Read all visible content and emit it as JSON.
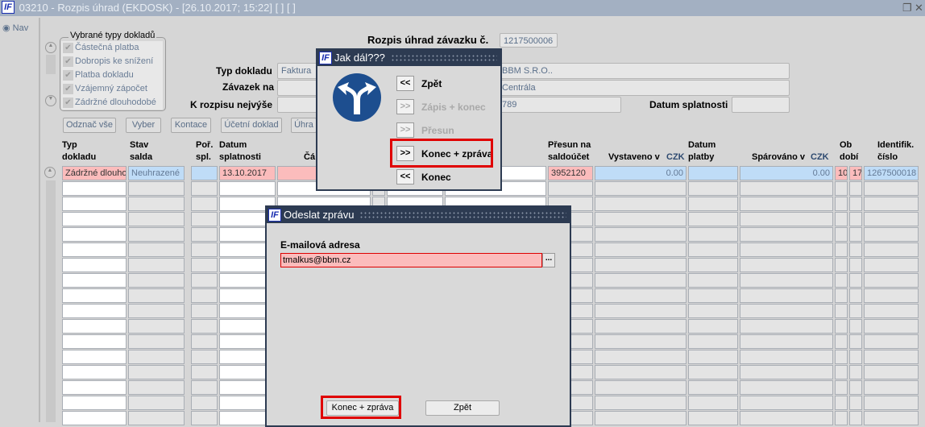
{
  "window": {
    "title": "03210 - Rozpis úhrad (EKDOSK) - [26.10.2017; 15:22]  [ ]  [ ]",
    "logo": "IF"
  },
  "nav": {
    "label": "Nav"
  },
  "doc_types": {
    "legend": "Vybrané typy dokladů",
    "items": [
      "Částečná platba",
      "Dobropis ke snížení",
      "Platba dokladu",
      "Vzájemný zápočet",
      "Zádržné dlouhodobé"
    ]
  },
  "header": {
    "title": "Rozpis úhrad závazku č.",
    "number": "1217500006",
    "typ_label": "Typ dokladu",
    "typ_value": "Faktura",
    "partner": "BBM S.R.O..",
    "zavazek_label": "Závazek na",
    "zavazek_value": "Centrála",
    "rozpis_label": "K rozpisu nejvýše",
    "rozpis_value": "789",
    "splatnost_label": "Datum splatnosti",
    "splatnost_value": ""
  },
  "toolbar": [
    "Odznač vše",
    "Vyber",
    "Kontace",
    "Účetní doklad",
    "Úhra"
  ],
  "table": {
    "headers": {
      "typ": "Typ\ndokladu",
      "stav": "Stav\nsalda",
      "por": "Poř.\nspl.",
      "datum": "Datum\nsplatnosti",
      "castka": "Čá",
      "presun": "Přesun na\nsaldoúčet",
      "vystaveno": "Vystaveno v",
      "czk": "CZK",
      "platby": "Datum\nplatby",
      "sparovano": "Spárováno v",
      "ob": "Ob\ndobí",
      "ident": "Identifik.\nčíslo"
    },
    "row": {
      "typ": "Zádržné dlouhodobé",
      "stav": "Neuhrazené",
      "datum": "13.10.2017",
      "presun": "3952120",
      "vystaveno": "0.00",
      "sparovano": "0.00",
      "ob1": "10",
      "ob2": "17",
      "ident": "1267500018"
    }
  },
  "dialog_jak": {
    "title": "Jak dál???",
    "options": [
      {
        "arrows": "<<",
        "label": "Zpět",
        "enabled": true
      },
      {
        "arrows": ">>",
        "label": "Zápis + konec",
        "enabled": false
      },
      {
        "arrows": ">>",
        "label": "Přesun",
        "enabled": false
      },
      {
        "arrows": ">>",
        "label": "Konec + zpráva",
        "enabled": true
      },
      {
        "arrows": "<<",
        "label": "Konec",
        "enabled": true
      }
    ]
  },
  "dialog_msg": {
    "title": "Odeslat zprávu",
    "email_label": "E-mailová adresa",
    "email_value": "tmalkus@bbm.cz",
    "browse": "...",
    "send": "Konec + zpráva",
    "back": "Zpět"
  },
  "colors": {
    "titlebar": "#a3b0c2",
    "dialog_title": "#2d3b52",
    "highlight": "#e00000",
    "required": "#fbbcbc",
    "readonly": "#bfdcf7"
  }
}
